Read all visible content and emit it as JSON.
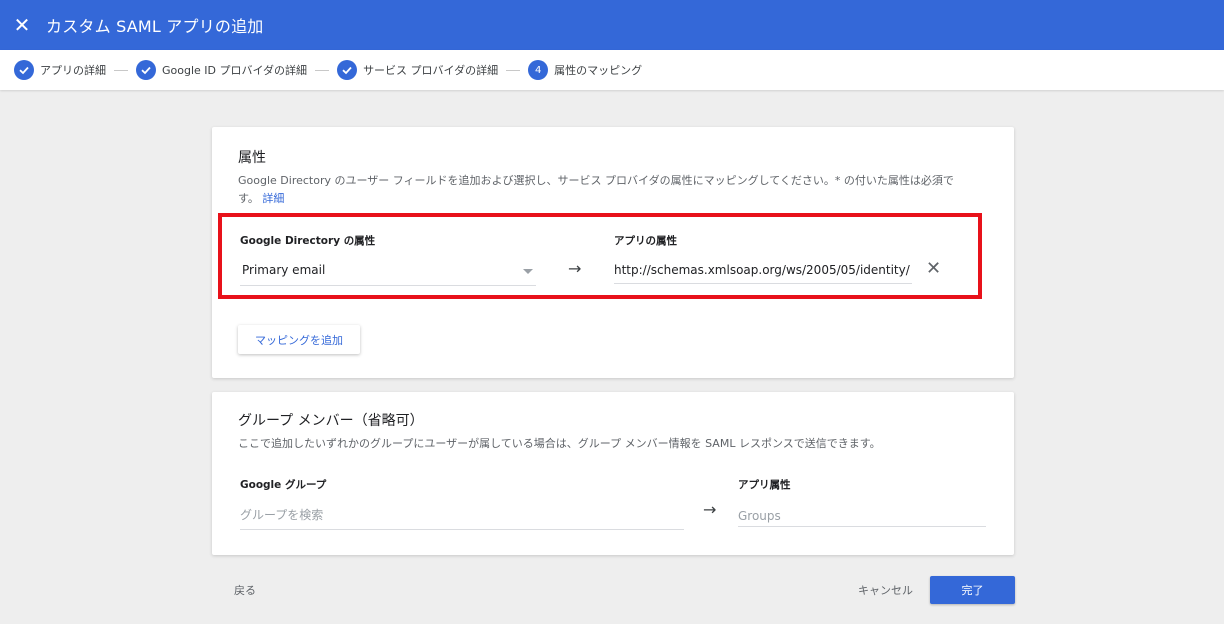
{
  "appbar": {
    "title": "カスタム SAML アプリの追加"
  },
  "stepper": {
    "steps": [
      {
        "label": "アプリの詳細"
      },
      {
        "label": "Google ID プロバイダの詳細"
      },
      {
        "label": "サービス プロバイダの詳細"
      },
      {
        "label": "属性のマッピング",
        "number": "4"
      }
    ]
  },
  "attributes": {
    "title": "属性",
    "desc_line1": "Google Directory のユーザー フィールドを追加および選択し、サービス プロバイダの属性にマッピングしてください。* の付いた属性は必須で",
    "desc_line2": "す。",
    "detail_link": "詳細",
    "directory_label": "Google Directory の属性",
    "directory_value": "Primary email",
    "app_label": "アプリの属性",
    "app_value": "http://schemas.xmlsoap.org/ws/2005/05/identity/",
    "arrow": "→",
    "add_mapping": "マッピングを追加"
  },
  "groups": {
    "title": "グループ メンバー（省略可）",
    "desc": "ここで追加したいずれかのグループにユーザーが属している場合は、グループ メンバー情報を SAML レスポンスで送信できます。",
    "google_group_label": "Google グループ",
    "google_group_placeholder": "グループを検索",
    "app_attr_label": "アプリ属性",
    "app_attr_placeholder": "Groups",
    "arrow": "→"
  },
  "footer": {
    "back": "戻る",
    "cancel": "キャンセル",
    "done": "完了"
  },
  "colors": {
    "primary": "#3468d8",
    "highlight": "#e8111a"
  }
}
